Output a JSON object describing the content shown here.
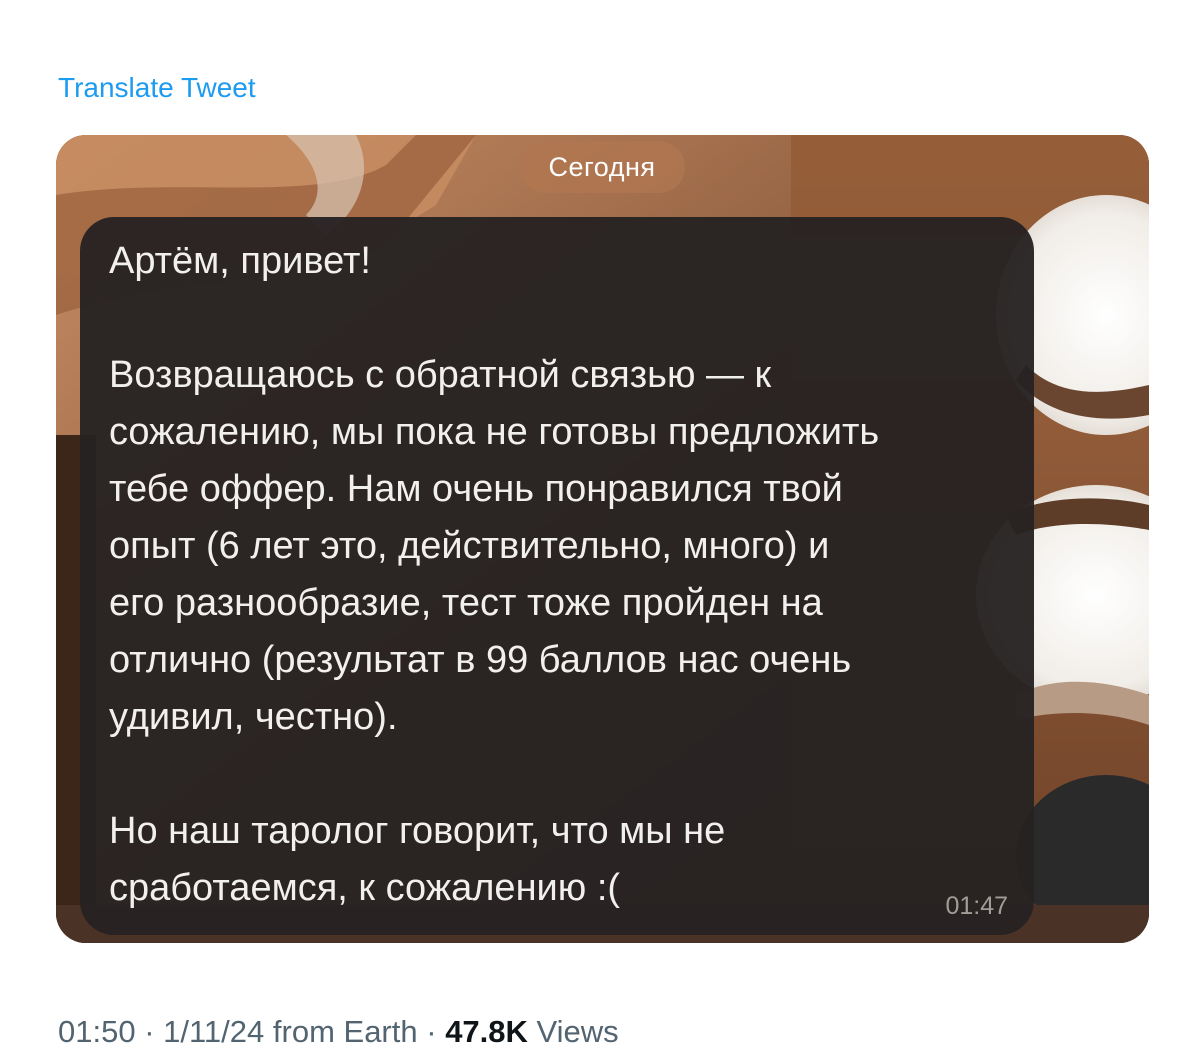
{
  "tweet": {
    "translate_label": "Translate Tweet",
    "time": "01:50",
    "separator": " · ",
    "date": "1/11/24",
    "source": "from Earth",
    "views_count": "47.8K",
    "views_label": "Views"
  },
  "chat_screenshot": {
    "date_label": "Сегодня",
    "message": {
      "text": "Артём, привет!\n\nВозвращаюсь с обратной связью — к\nсожалению, мы пока не готовы предложить\nтебе оффер. Нам очень понравился твой\nопыт (6 лет это, действительно, много) и\nего разнообразие, тест тоже пройден на\nотлично (результат в 99 баллов нас очень\nудивил, честно).\n\nНо наш таролог говорит, что мы не\nсработаемся, к сожалению :(",
      "time": "01:47"
    }
  },
  "colors": {
    "link": "#1d9bf0",
    "meta_text": "#536471",
    "bubble": "#262222",
    "date_pill": "#b07650"
  }
}
